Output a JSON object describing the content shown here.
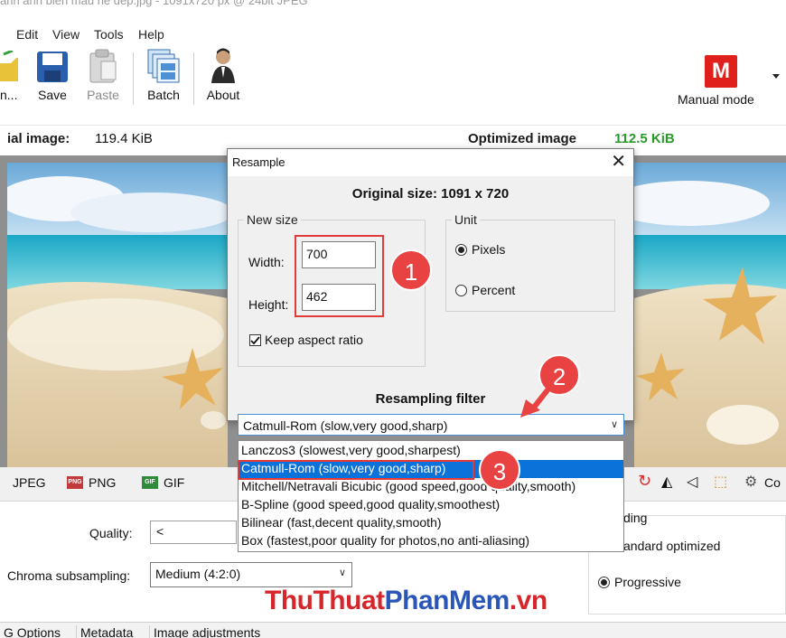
{
  "window": {
    "title": "anh anh bien mau ne dep.jpg - 1091x720 px @ 24bit JPEG"
  },
  "menu": [
    "Edit",
    "View",
    "Tools",
    "Help"
  ],
  "toolbar": {
    "truncated_label": "n...",
    "save": "Save",
    "paste": "Paste",
    "batch": "Batch",
    "about": "About",
    "mode_badge": "M",
    "mode_label": "Manual mode"
  },
  "sizes": {
    "original_label": "ial image:",
    "original_value": "119.4 KiB",
    "optimized_label": "Optimized image",
    "optimized_value": "112.5 KiB"
  },
  "formats": {
    "jpeg": "JPEG",
    "png": "PNG",
    "gif": "GIF",
    "png_icon": "PNG",
    "gif_icon": "GIF",
    "config": "Co"
  },
  "jpeg_options": {
    "quality_label": "Quality:",
    "quality_arrow": "<",
    "chroma_label": "Chroma subsampling:",
    "chroma_value": "Medium (4:2:0)",
    "encoding_label": "ding",
    "standard_label": "andard optimized",
    "progressive_label": "Progressive"
  },
  "bottom_tabs": [
    "G Options",
    "Metadata",
    "Image adjustments"
  ],
  "dialog": {
    "title": "Resample",
    "close": "✕",
    "original_size": "Original size: 1091 x 720",
    "new_size_caption": "New size",
    "width_label": "Width:",
    "width_value": "700",
    "height_label": "Height:",
    "height_value": "462",
    "keep_aspect": "Keep aspect ratio",
    "unit_caption": "Unit",
    "pixels": "Pixels",
    "percent": "Percent",
    "filter_title": "Resampling filter",
    "filter_selected": "Catmull-Rom (slow,very good,sharp)"
  },
  "filter_options": [
    "Lanczos3 (slowest,very good,sharpest)",
    "Catmull-Rom (slow,very good,sharp)",
    "Mitchell/Netravali Bicubic (good speed,good quality,smooth)",
    "B-Spline (good speed,good quality,smoothest)",
    "Bilinear (fast,decent quality,smooth)",
    "Box (fastest,poor quality for photos,no anti-aliasing)"
  ],
  "callouts": {
    "one": "1",
    "two": "2",
    "three": "3"
  },
  "watermark": {
    "part1": "ThuThuat",
    "part2": "PhanMem",
    "part3": ".vn"
  },
  "colors": {
    "accent_red": "#e23b3b",
    "selection_blue": "#0a72d8",
    "optimized_green": "#2a9a2a",
    "watermark_red": "#d7262b",
    "watermark_blue": "#2a56b8"
  }
}
